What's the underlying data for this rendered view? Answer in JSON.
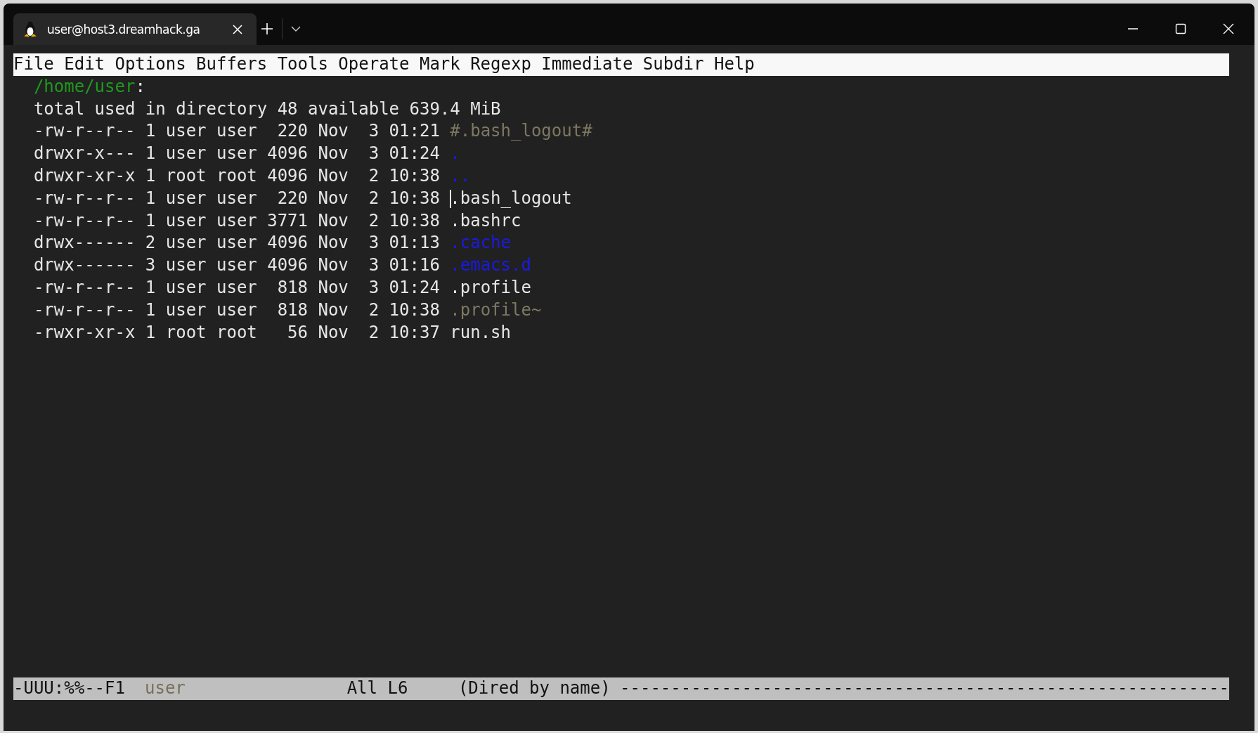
{
  "tab": {
    "title": "user@host3.dreamhack.ga",
    "selected": true
  },
  "menu": [
    "File",
    "Edit",
    "Options",
    "Buffers",
    "Tools",
    "Operate",
    "Mark",
    "Regexp",
    "Immediate",
    "Subdir",
    "Help"
  ],
  "directory": {
    "path": "/home/user",
    "suffix": ":"
  },
  "summary": "total used in directory 48 available 639.4 MiB",
  "entries": [
    {
      "details": "-rw-r--r-- 1 user user  220 Nov  3 01:21",
      "name": "#.bash_logout#",
      "kind": "autosave",
      "cursor": false
    },
    {
      "details": "drwxr-x--- 1 user user 4096 Nov  3 01:24",
      "name": ".",
      "kind": "directory",
      "cursor": false
    },
    {
      "details": "drwxr-xr-x 1 root root 4096 Nov  2 10:38",
      "name": "..",
      "kind": "directory",
      "cursor": false
    },
    {
      "details": "-rw-r--r-- 1 user user  220 Nov  2 10:38",
      "name": ".bash_logout",
      "kind": "file",
      "cursor": true
    },
    {
      "details": "-rw-r--r-- 1 user user 3771 Nov  2 10:38",
      "name": ".bashrc",
      "kind": "file",
      "cursor": false
    },
    {
      "details": "drwx------ 2 user user 4096 Nov  3 01:13",
      "name": ".cache",
      "kind": "directory",
      "cursor": false
    },
    {
      "details": "drwx------ 3 user user 4096 Nov  3 01:16",
      "name": ".emacs.d",
      "kind": "directory",
      "cursor": false
    },
    {
      "details": "-rw-r--r-- 1 user user  818 Nov  3 01:24",
      "name": ".profile",
      "kind": "file",
      "cursor": false
    },
    {
      "details": "-rw-r--r-- 1 user user  818 Nov  2 10:38",
      "name": ".profile~",
      "kind": "backup",
      "cursor": false
    },
    {
      "details": "-rwxr-xr-x 1 root root   56 Nov  2 10:37",
      "name": "run.sh",
      "kind": "file",
      "cursor": false
    }
  ],
  "mode_line": {
    "status": "-UUU:%%--F1",
    "buffer": "user",
    "position": "All L6",
    "mode": "(Dired by name)",
    "fill": "------------------------------------------------------------"
  }
}
